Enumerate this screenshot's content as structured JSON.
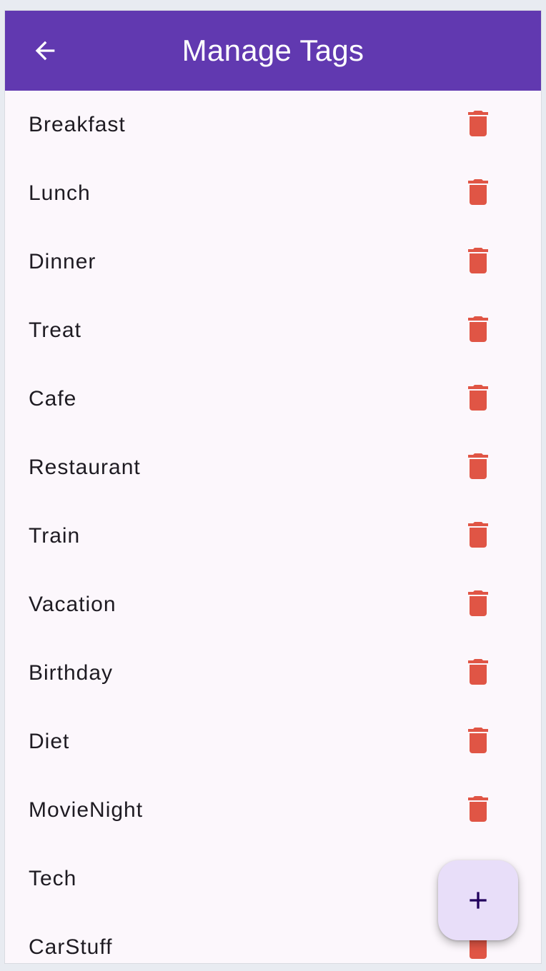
{
  "appbar": {
    "title": "Manage Tags",
    "back_icon": "arrow-left-icon"
  },
  "colors": {
    "appbar_bg": "#6139b0",
    "delete_icon": "#e05545",
    "fab_bg": "#e8def9",
    "fab_icon": "#21005d",
    "surface": "#fcf7fc"
  },
  "tags": [
    {
      "label": "Breakfast",
      "action_icon": "delete-icon"
    },
    {
      "label": "Lunch",
      "action_icon": "delete-icon"
    },
    {
      "label": "Dinner",
      "action_icon": "delete-icon"
    },
    {
      "label": "Treat",
      "action_icon": "delete-icon"
    },
    {
      "label": "Cafe",
      "action_icon": "delete-icon"
    },
    {
      "label": "Restaurant",
      "action_icon": "delete-icon"
    },
    {
      "label": "Train",
      "action_icon": "delete-icon"
    },
    {
      "label": "Vacation",
      "action_icon": "delete-icon"
    },
    {
      "label": "Birthday",
      "action_icon": "delete-icon"
    },
    {
      "label": "Diet",
      "action_icon": "delete-icon"
    },
    {
      "label": "MovieNight",
      "action_icon": "delete-icon"
    },
    {
      "label": "Tech",
      "action_icon": "delete-icon"
    },
    {
      "label": "CarStuff",
      "action_icon": "delete-icon"
    }
  ],
  "fab": {
    "icon": "plus-icon"
  }
}
